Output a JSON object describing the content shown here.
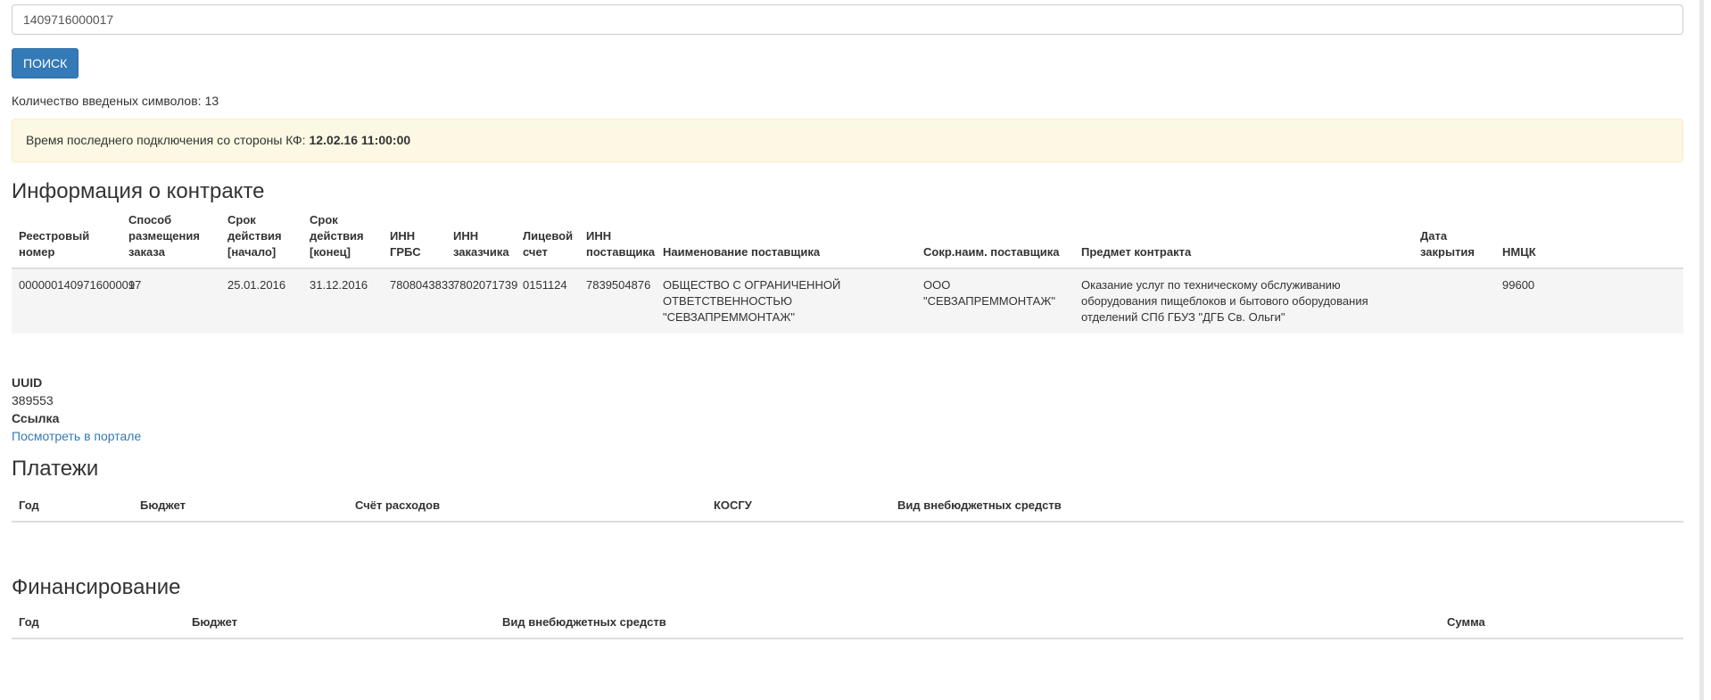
{
  "search": {
    "value": "1409716000017",
    "button_label": "ПОИСК"
  },
  "counter": {
    "label": "Количество введеных символов:",
    "value": "13"
  },
  "alert": {
    "text": "Время последнего подключения со стороны КФ:",
    "value": "12.02.16 11:00:00"
  },
  "contract": {
    "title": "Информация о контракте",
    "headers": [
      "Реестровый номер",
      "Способ размещения заказа",
      "Срок действия [начало]",
      "Срок действия [конец]",
      "ИНН ГРБС",
      "ИНН заказчика",
      "Лицевой счет",
      "ИНН поставщика",
      "Наименование поставщика",
      "Сокр.наим. поставщика",
      "Предмет контракта",
      "Дата закрытия",
      "НМЦК"
    ],
    "rows": [
      [
        "0000001409716000017",
        "9",
        "25.01.2016",
        "31.12.2016",
        "7808043833",
        "7802071739",
        "0151124",
        "7839504876",
        "ОБЩЕСТВО С ОГРАНИЧЕННОЙ ОТВЕТСТВЕННОСТЬЮ \"СЕВЗАПРЕММОНТАЖ\"",
        "ООО \"СЕВЗАПРЕММОНТАЖ\"",
        "Оказание услуг по техническому обслуживанию оборудования пищеблоков и бытового оборудования отделений СПб ГБУЗ \"ДГБ Св. Ольги\"",
        "",
        "99600"
      ]
    ]
  },
  "meta": {
    "uuid_label": "UUID",
    "uuid_value": "389553",
    "link_label": "Ссылка",
    "link_text": "Посмотреть в портале"
  },
  "payments": {
    "title": "Платежи",
    "headers": [
      "Год",
      "Бюджет",
      "Счёт расходов",
      "КОСГУ",
      "Вид внебюджетных средств"
    ]
  },
  "financing": {
    "title": "Финансирование",
    "headers": [
      "Год",
      "Бюджет",
      "Вид внебюджетных средств",
      "Сумма"
    ]
  }
}
